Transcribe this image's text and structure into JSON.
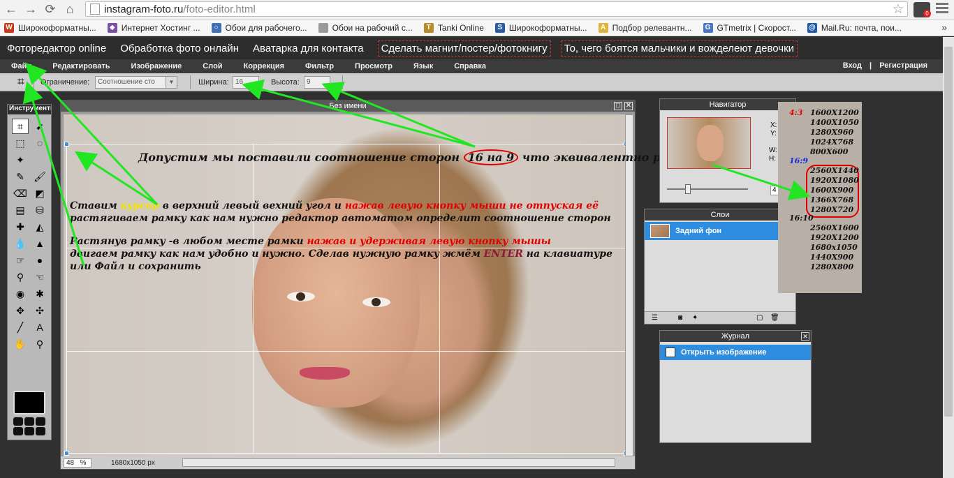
{
  "browser": {
    "url_host": "instagram-foto.ru",
    "url_path": "/foto-editor.html",
    "ext_badge": "0"
  },
  "bookmarks": [
    {
      "label": "Широкоформатны...",
      "color": "#c83a1a",
      "glyph": "W"
    },
    {
      "label": "Интернет Хостинг ...",
      "color": "#7b4fa6",
      "glyph": "◆"
    },
    {
      "label": "Обои для рабочего...",
      "color": "#3f6fb5",
      "glyph": "○"
    },
    {
      "label": "Обои на рабочий с...",
      "color": "#9a9a9a",
      "glyph": ""
    },
    {
      "label": "Tanki Online",
      "color": "#b88a2a",
      "glyph": "T"
    },
    {
      "label": "Широкоформатны...",
      "color": "#2a5da8",
      "glyph": "S"
    },
    {
      "label": "Подбор релевантн...",
      "color": "#e0b43a",
      "glyph": "A"
    },
    {
      "label": "GTmetrix | Скорост...",
      "color": "#4a77c2",
      "glyph": "G"
    },
    {
      "label": "Mail.Ru: почта, пои...",
      "color": "#1e5aa8",
      "glyph": "@"
    }
  ],
  "site_nav": [
    {
      "label": "Фоторедактор online",
      "dashed": false
    },
    {
      "label": "Обработка фото онлайн",
      "dashed": false
    },
    {
      "label": "Аватарка для контакта",
      "dashed": false
    },
    {
      "label": "Сделать магнит/постер/фотокнигу",
      "dashed": true
    },
    {
      "label": "То, чего боятся мальчики и вожделеют девочки",
      "dashed": true
    }
  ],
  "editor_menu": [
    "Файл",
    "Редактировать",
    "Изображение",
    "Слой",
    "Коррекция",
    "Фильтр",
    "Просмотр",
    "Язык",
    "Справка"
  ],
  "auth": {
    "login": "Вход",
    "sep": "|",
    "register": "Регистрация"
  },
  "options": {
    "constraint_label": "Ограничение:",
    "constraint_value": "Соотношение сто",
    "width_label": "Ширина:",
    "width_value": "16",
    "height_label": "Высота:",
    "height_value": "9"
  },
  "tools_title": "Инструменты",
  "doc": {
    "title": "Без имени",
    "zoom": "48",
    "zoom_unit": "%",
    "dims": "1680x1050 px"
  },
  "annotations": {
    "headline_a": "Допустим мы поставили соотношение сторон ",
    "headline_16": "16",
    "headline_na": " на ",
    "headline_9": "9",
    "headline_b": " что эквивалентно разрешениям",
    "p1_a": "Ставим ",
    "p1_cursor": "курсор",
    "p1_b": " в верхний  левый вехний угол и ",
    "p1_red": "нажав левую кнопку мыши не отпуская её",
    "p1_line2": "растягиваем рамку как нам нужно редактор автоматом определит соотношение сторон",
    "p2_a": "Растянув рамку -в любом месте рамки ",
    "p2_red": "нажав и удерживая левую кнопку мышы",
    "p2_line2_a": "двигаем рамку как нам удобно и нужно. Сделав нужную рамку жмём ",
    "p2_enter": "ENTER",
    "p2_line2_b": " на клавиатуре",
    "p2_line3": "или Файл и сохранить"
  },
  "navigator": {
    "title": "Навигатор",
    "x_label": "X:",
    "y_label": "Y:",
    "w_label": "W:",
    "h_label": "H:",
    "zoom_field": "4"
  },
  "layers": {
    "title": "Слои",
    "item": "Задний фон"
  },
  "journal": {
    "title": "Журнал",
    "item": "Открыть изображение"
  },
  "resolutions": {
    "r43": "4:3",
    "list43": [
      "1600X1200",
      "1400X1050",
      "1280X960",
      "1024X768",
      "800X600"
    ],
    "r169": "16:9",
    "list169": [
      "2560X1440",
      "1920X1080",
      "1600X900",
      "1366X768",
      "1280X720"
    ],
    "r1610": "16:10",
    "list1610": [
      "2560X1600",
      "1920X1200",
      "1680x1050",
      "1440X900",
      "1280X800"
    ]
  },
  "colors": {
    "annotation_red": "#e00000",
    "arrow_green": "#22e622",
    "cursor_yellow": "#f3e300",
    "enter_maroon": "#8b1a3a",
    "selection_blue": "#2f8de0"
  }
}
